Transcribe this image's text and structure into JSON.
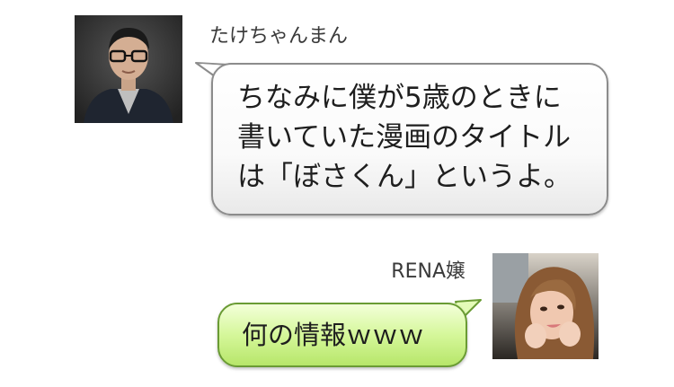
{
  "messages": [
    {
      "sender": "たけちゃんまん",
      "lines": [
        "ちなみに僕が5歳のときに",
        "書いていた漫画のタイトル",
        "は「ぼさくん」というよ。"
      ]
    },
    {
      "sender": "RENA嬢",
      "text": "何の情報ｗｗｗ"
    }
  ]
}
